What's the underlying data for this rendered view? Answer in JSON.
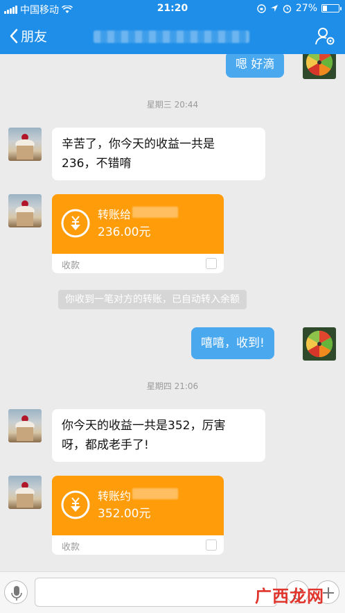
{
  "status_bar": {
    "carrier": "中国移动",
    "time": "21:20",
    "battery": "27%",
    "battery_level": 0.27
  },
  "nav": {
    "back_label": "朋友"
  },
  "messages": [
    {
      "side": "right",
      "text": "嗯 好滴"
    },
    {
      "timestamp": "星期三 20:44"
    },
    {
      "side": "left",
      "text_lines": [
        "辛苦了，你今天的收益一共是",
        "236，不错唷"
      ]
    },
    {
      "type": "transfer",
      "title": "转账给",
      "amount": "236.00元",
      "collect": "收款"
    },
    {
      "notice": "你收到一笔对方的转账，已自动转入余额"
    },
    {
      "side": "right",
      "text": "嘻嘻，收到!"
    },
    {
      "timestamp": "星期四 21:06"
    },
    {
      "side": "left",
      "text_lines": [
        "你今天的收益一共是352，厉害",
        "呀，都成老手了!"
      ]
    },
    {
      "type": "transfer",
      "title": "转账约",
      "amount": "352.00元",
      "collect": "收款"
    }
  ],
  "watermark": "广西龙网",
  "colors": {
    "nav": "#1e8ee8",
    "bubble_right": "#4aa8ee",
    "transfer": "#ff9c0a",
    "background": "#ebebeb"
  },
  "icons": [
    "signal-icon",
    "wifi-icon",
    "lock-rotation-icon",
    "location-icon",
    "alarm-icon",
    "battery-icon",
    "back-chevron-icon",
    "profile-settings-icon",
    "currency-down-icon",
    "alipay-icon",
    "microphone-icon",
    "emoji-icon",
    "plus-icon"
  ]
}
